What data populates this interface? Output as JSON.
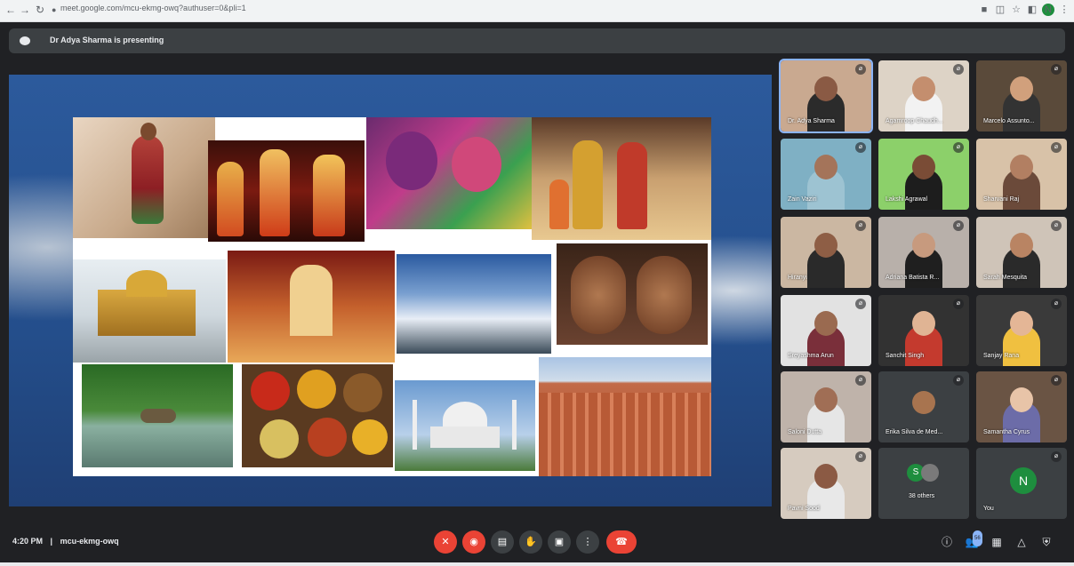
{
  "browser": {
    "url": "meet.google.com/mcu-ekmg-owq?authuser=0&pli=1",
    "profile_initial": "N",
    "nav_icons": [
      "back-icon",
      "forward-icon",
      "reload-icon",
      "lock-icon"
    ],
    "tool_icons": [
      "camera-permission-icon",
      "translate-icon",
      "star-icon",
      "extensions-icon",
      "menu-icon"
    ]
  },
  "presenting_bar": {
    "text": "Dr Adya Sharma is presenting"
  },
  "presentation": {
    "photos": [
      {
        "subject": "bharatanatyam-dancer"
      },
      {
        "subject": "folk-dancers"
      },
      {
        "subject": "holi-festival"
      },
      {
        "subject": "diwali-family"
      },
      {
        "subject": "golden-temple"
      },
      {
        "subject": "temple-interior"
      },
      {
        "subject": "clouds-mountains"
      },
      {
        "subject": "henna-hands"
      },
      {
        "subject": "kerala-backwaters"
      },
      {
        "subject": "spices"
      },
      {
        "subject": "taj-mahal"
      },
      {
        "subject": "hawa-mahal"
      }
    ]
  },
  "participants": [
    {
      "name": "Dr. Adya Sharma",
      "bg": "#c9a990",
      "skin": "#8a5a44",
      "shirt": "#2b2b2b",
      "pinned": true
    },
    {
      "name": "Agamroop Chaudh...",
      "bg": "#ddd3c6",
      "skin": "#c48e6e",
      "shirt": "#f2f2f2"
    },
    {
      "name": "Marcelo Assunto...",
      "bg": "#5a4a3a",
      "skin": "#d1a07c",
      "shirt": "#333333"
    },
    {
      "name": "Zain Vaziri",
      "bg": "#7fb0c4",
      "skin": "#a4745a",
      "shirt": "#9dc3d2"
    },
    {
      "name": "Lakshi Agrawal",
      "bg": "#8cd06a",
      "skin": "#7a4c36",
      "shirt": "#1d1d1d"
    },
    {
      "name": "Sharvani Raj",
      "bg": "#d8c2a8",
      "skin": "#b27f62",
      "shirt": "#6b4a3a"
    },
    {
      "name": "Hiranyi",
      "bg": "#cbb7a2",
      "skin": "#8e5e45",
      "shirt": "#2a2a2a"
    },
    {
      "name": "Adriana Batista R...",
      "bg": "#b8b0aa",
      "skin": "#c79a7e",
      "shirt": "#1f1f1f"
    },
    {
      "name": "Sarah Mesquita",
      "bg": "#cfc4b8",
      "skin": "#b98463",
      "shirt": "#2a2a2a"
    },
    {
      "name": "Sreyashma Arun",
      "bg": "#e2e2e2",
      "skin": "#9a6a50",
      "shirt": "#7a2f3a"
    },
    {
      "name": "Sanchit Singh",
      "bg": "#323232",
      "skin": "#e0b494",
      "shirt": "#c43a2e"
    },
    {
      "name": "Sanjay Rana",
      "bg": "#3a3a3a",
      "skin": "#e4b696",
      "shirt": "#f0c040"
    },
    {
      "name": "Saloni Dutta",
      "bg": "#bfb3aa",
      "skin": "#a06e55",
      "shirt": "#e6e6e6"
    },
    {
      "name": "Erika Silva de Med...",
      "bg": "#3c4043",
      "skin": "#a8744f",
      "shirt": "#3c4043",
      "is_photo_avatar": true
    },
    {
      "name": "Samantha Cyrus",
      "bg": "#6a5444",
      "skin": "#e8c4a8",
      "shirt": "#6c6ca8"
    },
    {
      "name": "Pavni Sood",
      "bg": "#d6cbbf",
      "skin": "#8b5a44",
      "shirt": "#e8e8e8"
    }
  ],
  "others_tile": {
    "label": "38 others",
    "avatar_color": "#1e8e3e",
    "avatar_initial": "S"
  },
  "self_tile": {
    "label": "You",
    "initial": "N",
    "avatar_color": "#1e8e3e"
  },
  "meeting": {
    "time": "4:20 PM",
    "separator": "|",
    "code": "mcu-ekmg-owq"
  },
  "controls": {
    "mic_icon": "mic-off-icon",
    "cam_icon": "camera-off-icon",
    "captions_icon": "captions-icon",
    "hand_icon": "raise-hand-icon",
    "present_icon": "present-icon",
    "more_icon": "more-icon",
    "leave_icon": "leave-call-icon"
  },
  "right_controls": {
    "participants_count": "56"
  },
  "colors": {
    "accent_red": "#ea4335",
    "meet_bg": "#202124",
    "control_gray": "#3c4043",
    "green": "#1e8e3e",
    "blue": "#8ab4f8"
  }
}
